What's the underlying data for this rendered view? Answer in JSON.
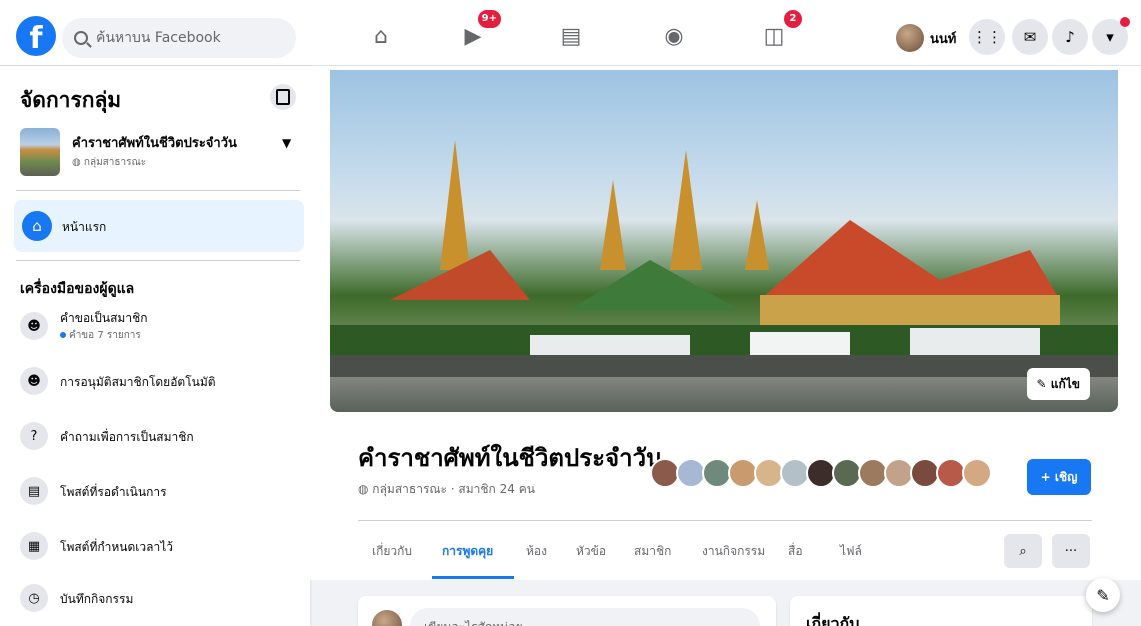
{
  "topbar": {
    "logo": "f",
    "search_placeholder": "ค้นหาบน Facebook",
    "nav": [
      {
        "name": "home",
        "icon": "home-icon"
      },
      {
        "name": "watch",
        "icon": "video-icon",
        "badge": "9+"
      },
      {
        "name": "marketplace",
        "icon": "store-icon"
      },
      {
        "name": "groups",
        "icon": "groups-icon"
      },
      {
        "name": "gaming",
        "icon": "gaming-icon",
        "badge": "2"
      }
    ],
    "profile_name": "นนท์"
  },
  "sidebar": {
    "title": "จัดการกลุ่ม",
    "group_name": "คำราชาศัพท์ในชีวิตประจำวัน",
    "group_privacy": "กลุ่มสาธารณะ",
    "home_label": "หน้าแรก",
    "tools_heading": "เครื่องมือของผู้ดูแล",
    "tools": [
      {
        "label": "คำขอเป็นสมาชิก",
        "sub": "คำขอ 7 รายการ",
        "icon": "member-request-icon"
      },
      {
        "label": "การอนุมัติสมาชิกโดยอัตโนมัติ",
        "icon": "auto-approve-icon"
      },
      {
        "label": "คำถามเพื่อการเป็นสมาชิก",
        "icon": "questions-icon"
      },
      {
        "label": "โพสต์ที่รอดำเนินการ",
        "icon": "pending-posts-icon"
      },
      {
        "label": "โพสต์ที่กำหนดเวลาไว้",
        "icon": "scheduled-posts-icon"
      },
      {
        "label": "บันทึกกิจกรรม",
        "icon": "activity-log-icon"
      }
    ]
  },
  "main": {
    "edit_label": "แก้ไข",
    "group_title": "คำราชาศัพท์ในชีวิตประจำวัน",
    "group_meta": "กลุ่มสาธารณะ · สมาชิก 24 คน",
    "invite_label": "+ เชิญ",
    "tabs": [
      "เกี่ยวกับ",
      "การพูดคุย",
      "ห้อง",
      "หัวข้อ",
      "สมาชิก",
      "งานกิจกรรม",
      "สื่อ",
      "ไฟล์"
    ],
    "active_tab": "การพูดคุย",
    "composer_placeholder": "เขียนอะไรสักหน่อย...",
    "about_heading": "เกี่ยวกับ"
  },
  "colors": {
    "brand": "#1877f2",
    "badge": "#e41e3f"
  }
}
